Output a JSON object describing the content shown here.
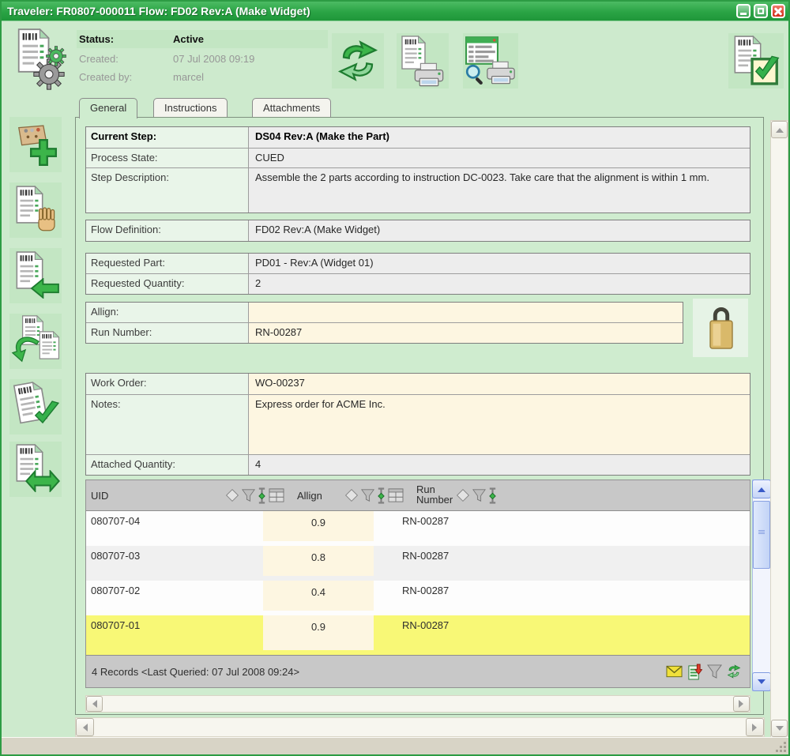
{
  "window": {
    "title": "Traveler: FR0807-000011 Flow: FD02 Rev:A (Make Widget)"
  },
  "header": {
    "status_label": "Status:",
    "status_value": "Active",
    "created_label": "Created:",
    "created_value": "07 Jul 2008 09:19",
    "createdby_label": "Created by:",
    "createdby_value": "marcel"
  },
  "tabs": [
    {
      "label": "General",
      "active": true
    },
    {
      "label": "Instructions",
      "active": false
    },
    {
      "label": "Attachments",
      "active": false
    }
  ],
  "form": {
    "groups": [
      {
        "rows": [
          {
            "label": "Current Step:",
            "value": "DS04 Rev:A (Make the Part)"
          },
          {
            "label": "Process State:",
            "value": "CUED"
          },
          {
            "label": "Step Description:",
            "value": "Assemble the 2 parts according to instruction DC-0023. Take care that the alignment is within 1 mm."
          }
        ]
      },
      {
        "rows": [
          {
            "label": "Flow Definition:",
            "value": "FD02 Rev:A (Make Widget)"
          }
        ]
      },
      {
        "rows": [
          {
            "label": "Requested Part:",
            "value": "PD01 - Rev:A (Widget 01)"
          },
          {
            "label": "Requested Quantity:",
            "value": "2"
          }
        ]
      },
      {
        "rows": [
          {
            "label": "Allign:",
            "value": ""
          },
          {
            "label": "Run Number:",
            "value": "RN-00287"
          }
        ]
      },
      {
        "rows": [
          {
            "label": "Work Order:",
            "value": "WO-00237"
          },
          {
            "label": "Notes:",
            "value": "Express order for ACME Inc."
          },
          {
            "label": "Attached Quantity:",
            "value": "4"
          }
        ]
      }
    ]
  },
  "table": {
    "columns": [
      "UID",
      "Allign",
      "Run Number"
    ],
    "rows": [
      {
        "uid": "080707-04",
        "allign": "0.9",
        "run": "RN-00287"
      },
      {
        "uid": "080707-03",
        "allign": "0.8",
        "run": "RN-00287"
      },
      {
        "uid": "080707-02",
        "allign": "0.4",
        "run": "RN-00287"
      },
      {
        "uid": "080707-01",
        "allign": "0.9",
        "run": "RN-00287"
      }
    ],
    "footer": "4 Records <Last Queried: 07 Jul 2008 09:24>"
  },
  "colors": {
    "title_bar_green": "#2aa445",
    "window_background": "#cdeacd",
    "tile_green": "#c3e6c3",
    "field_cream": "#fdf6e1",
    "field_gray": "#ededed",
    "label_green": "#e9f5e9",
    "table_header_gray": "#c8c8c8",
    "selected_row_yellow": "#f8f876"
  }
}
